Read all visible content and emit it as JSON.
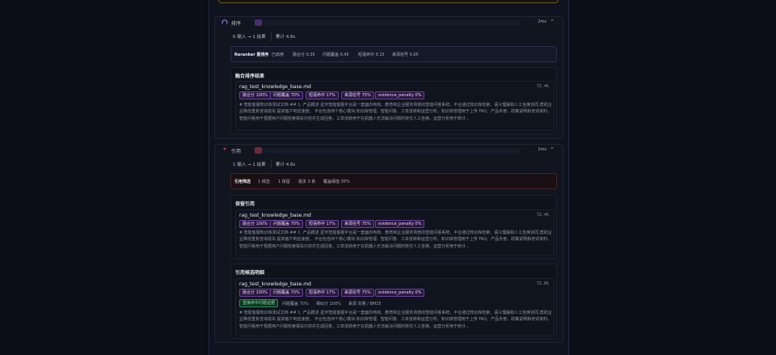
{
  "stages": [
    {
      "name": "排序",
      "icon": "sort-arc-icon",
      "time": "2ms",
      "io": "6 输入 → 1 结果",
      "cumulative": "累计 4.8s",
      "info": [
        "Reranker 重排序",
        "已启用",
        "融合分 0.35",
        "问题覆盖 0.45",
        "短语命中 0.15",
        "来源信号 0.05"
      ],
      "sections": [
        {
          "title": "融合排序结果",
          "docs": [
            {
              "name": "rag_test_knowledge_base.md",
              "score": "72.4%",
              "tags": [
                "融合分 100%",
                "问题覆盖 70%",
                "短语命中 17%",
                "来源信号 75%",
                "evidence_penalty 0%"
              ],
              "snippet": "# 智能客服知识库测试文档 ## 1. 产品概述 星环智能客服平台是一套面向电商、教育和企业服务场景的智能问答系统。平台通过知识库检索、语义理解和人工坐席协同,帮助企业降低重复咨询成本,提高客户响应速度。 平台包含四个核心模块:知识库管理、智能问答、工单流转和运营分析。知识库管理用于上传 FAQ、产品手册、政策说明和培训资料。智能问答用于根据用户问题检索相关内容并生成回答。工单流转用于在机器人无法解决问题时转交人工坐席。运营分析用于统计..."
            }
          ]
        }
      ]
    },
    {
      "name": "引用",
      "icon": "quote-icon",
      "time": "1ms",
      "io": "1 输入 → 1 结果",
      "cumulative": "累计 4.8s",
      "info": [
        "引用筛选",
        "1 候选",
        "1 保留",
        "最多 3 条",
        "覆盖阈值 35%"
      ],
      "sections": [
        {
          "title": "保留引用",
          "docs": [
            {
              "name": "rag_test_knowledge_base.md",
              "score": "72.4%",
              "tags": [
                "融合分 100%",
                "问题覆盖 70%",
                "短语命中 17%",
                "来源信号 75%",
                "evidence_penalty 0%"
              ],
              "snippet": "# 智能客服知识库测试文档 ## 1. 产品概述 星环智能客服平台是一套面向电商、教育和企业服务场景的智能问答系统。平台通过知识库检索、语义理解和人工坐席协同,帮助企业降低重复咨询成本,提高客户响应速度。 平台包含四个核心模块:知识库管理、智能问答、工单流转和运营分析。知识库管理用于上传 FAQ、产品手册、政策说明和培训资料。智能问答用于根据用户问题检索相关内容并生成回答。工单流转用于在机器人无法解决问题时转交人工坐席。运营分析用于统计..."
            }
          ]
        },
        {
          "title": "引用候选明细",
          "docs": [
            {
              "name": "rag_test_knowledge_base.md",
              "score": "72.8%",
              "tags": [
                "融合分 100%",
                "问题覆盖 70%",
                "短语命中 17%",
                "来源信号 75%",
                "evidence_penalty 0%"
              ],
              "status": "直接命中问题证据",
              "extras": [
                "问题覆盖 70%",
                "相似分 100%",
                "来源 向量 / BM25"
              ],
              "snippet": "# 智能客服知识库测试文档 ## 1. 产品概述 星环智能客服平台是一套面向电商、教育和企业服务场景的智能问答系统。平台通过知识库检索、语义理解和人工坐席协同,帮助企业降低重复咨询成本,提高客户响应速度。 平台包含四个核心模块:知识库管理、智能问答、工单流转和运营分析。知识库管理用于上传 FAQ、产品手册、政策说明和培训资料。智能问答用于根据用户问题检索相关内容并生成回答。工单流转用于在机器人无法解决问题时转交人工坐席。运营分析用于统计..."
            }
          ]
        }
      ]
    }
  ],
  "colors": {
    "accent_purple": "#6a3f9a",
    "rerank_chip": "#4a2e6e",
    "cite_chip": "#6e2a36",
    "status_green": "#2f8a55"
  }
}
